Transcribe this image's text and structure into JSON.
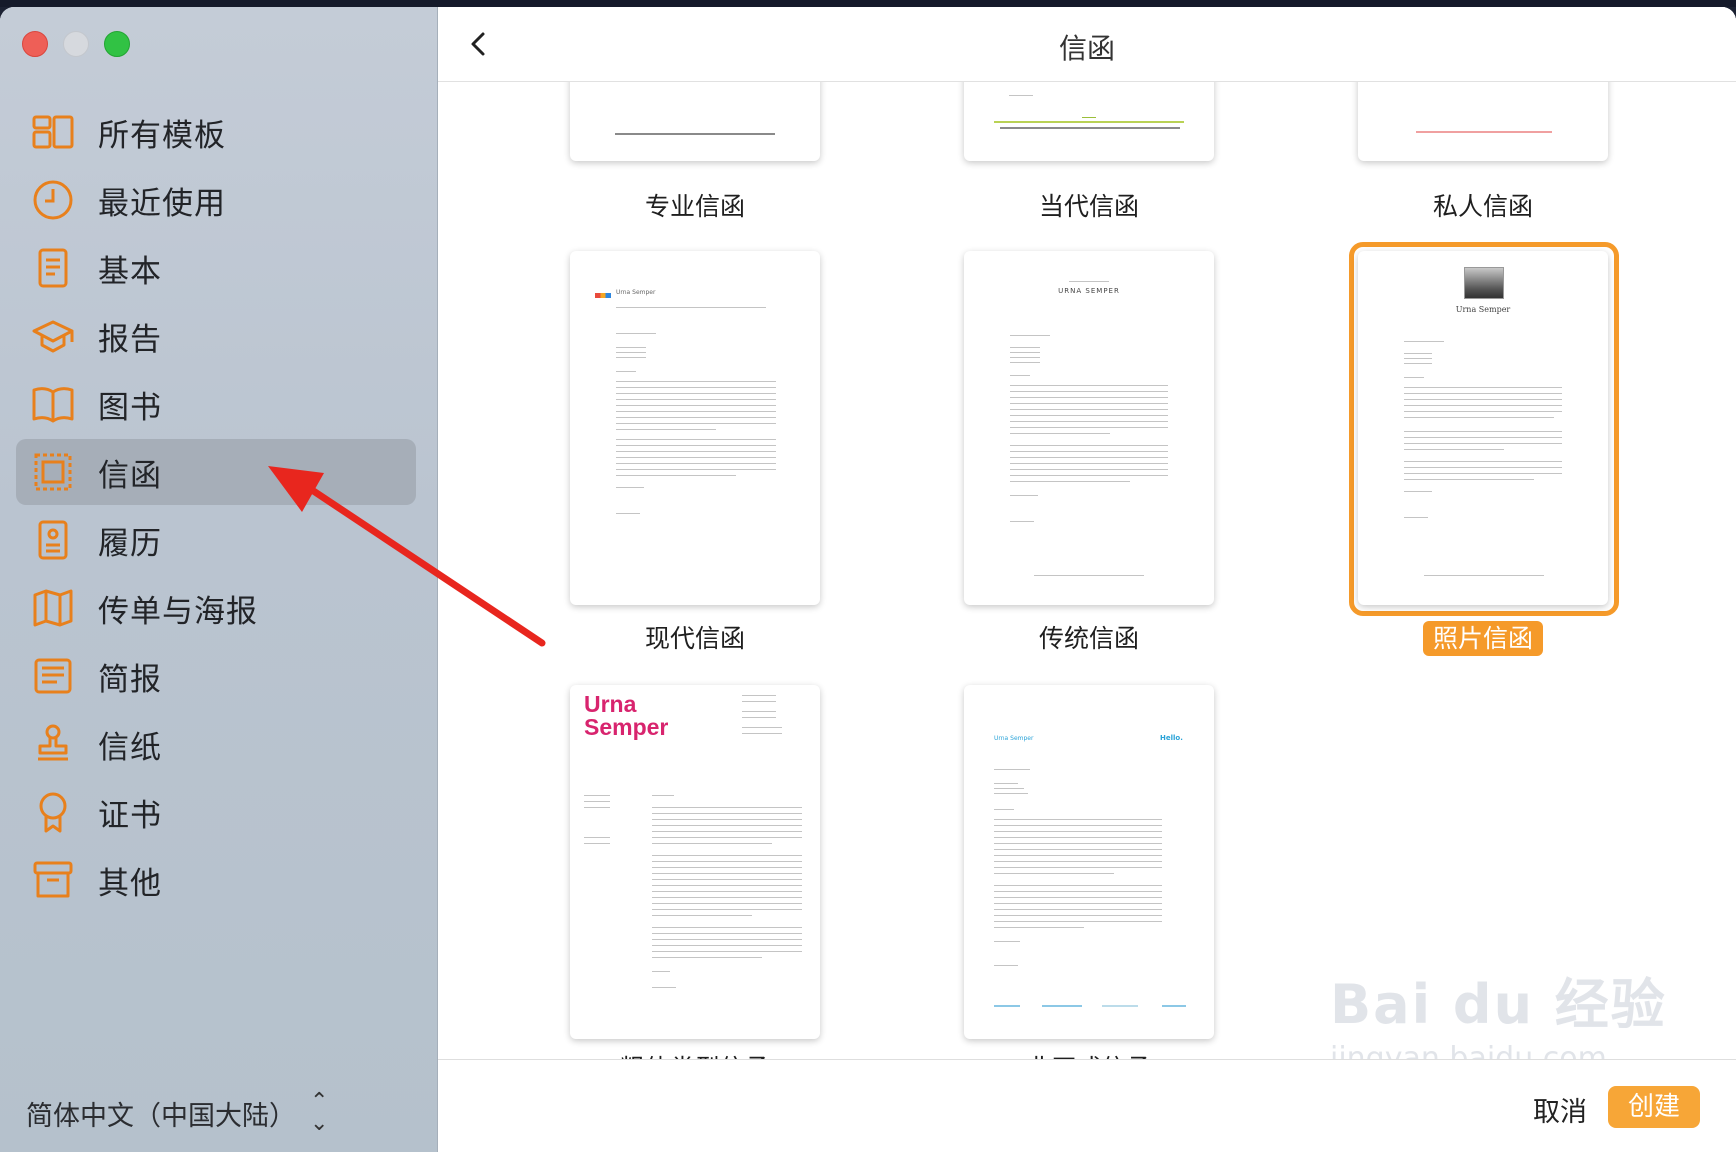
{
  "window": {
    "title": "信函"
  },
  "colors": {
    "accent": "#f59a2a",
    "icon": "#e8801c",
    "annotation_arrow": "#e8261e"
  },
  "sidebar": {
    "items": [
      {
        "label": "所有模板",
        "icon": "all-templates-icon"
      },
      {
        "label": "最近使用",
        "icon": "clock-icon"
      },
      {
        "label": "基本",
        "icon": "document-icon"
      },
      {
        "label": "报告",
        "icon": "graduation-cap-icon"
      },
      {
        "label": "图书",
        "icon": "book-icon"
      },
      {
        "label": "信函",
        "icon": "stamp-icon",
        "selected": true
      },
      {
        "label": "履历",
        "icon": "resume-icon"
      },
      {
        "label": "传单与海报",
        "icon": "map-icon"
      },
      {
        "label": "简报",
        "icon": "newsletter-icon"
      },
      {
        "label": "信纸",
        "icon": "seal-stamp-icon"
      },
      {
        "label": "证书",
        "icon": "ribbon-icon"
      },
      {
        "label": "其他",
        "icon": "archive-box-icon"
      }
    ],
    "language": "简体中文（中国大陆）"
  },
  "templates": [
    {
      "label": "专业信函"
    },
    {
      "label": "当代信函"
    },
    {
      "label": "私人信函"
    },
    {
      "label": "现代信函"
    },
    {
      "label": "传统信函"
    },
    {
      "label": "照片信函",
      "selected": true
    },
    {
      "label": "粗体类型信函",
      "partial": true
    },
    {
      "label": "非正式信函",
      "partial": true
    }
  ],
  "previews": {
    "bold_name_line1": "Urna",
    "bold_name_line2": "Semper",
    "modern_name": "Urna Semper",
    "traditional_name": "URNA SEMPER",
    "photo_name": "Urna Semper",
    "informal_name": "Urna Semper",
    "informal_greeting": "Hello."
  },
  "footer": {
    "cancel": "取消",
    "create": "创建"
  },
  "watermark": {
    "main": "Bai du 经验",
    "sub": "jingyan.baidu.com"
  }
}
